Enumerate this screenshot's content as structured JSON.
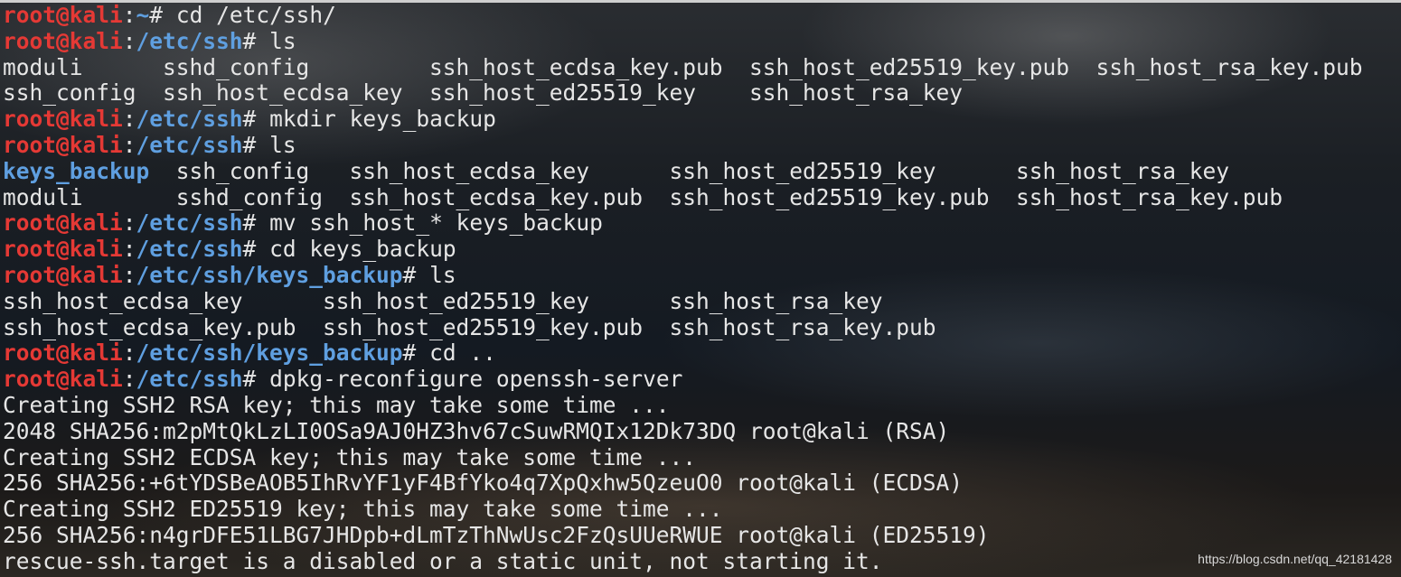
{
  "prompt": {
    "user_host": "root@kali",
    "colon": ":",
    "hash": "#"
  },
  "lines": [
    {
      "type": "prompt",
      "path": "~",
      "cmd": " cd /etc/ssh/"
    },
    {
      "type": "prompt",
      "path": "/etc/ssh",
      "cmd": " ls"
    },
    {
      "type": "text",
      "text": "moduli      sshd_config         ssh_host_ecdsa_key.pub  ssh_host_ed25519_key.pub  ssh_host_rsa_key.pub"
    },
    {
      "type": "text",
      "text": "ssh_config  ssh_host_ecdsa_key  ssh_host_ed25519_key    ssh_host_rsa_key"
    },
    {
      "type": "prompt",
      "path": "/etc/ssh",
      "cmd": " mkdir keys_backup"
    },
    {
      "type": "prompt",
      "path": "/etc/ssh",
      "cmd": " ls"
    },
    {
      "type": "listing",
      "dir": "keys_backup",
      "rest": "  ssh_config   ssh_host_ecdsa_key      ssh_host_ed25519_key      ssh_host_rsa_key"
    },
    {
      "type": "text",
      "text": "moduli       sshd_config  ssh_host_ecdsa_key.pub  ssh_host_ed25519_key.pub  ssh_host_rsa_key.pub"
    },
    {
      "type": "prompt",
      "path": "/etc/ssh",
      "cmd": " mv ssh_host_* keys_backup"
    },
    {
      "type": "prompt",
      "path": "/etc/ssh",
      "cmd": " cd keys_backup"
    },
    {
      "type": "prompt",
      "path": "/etc/ssh/keys_backup",
      "cmd": " ls"
    },
    {
      "type": "text",
      "text": "ssh_host_ecdsa_key      ssh_host_ed25519_key      ssh_host_rsa_key"
    },
    {
      "type": "text",
      "text": "ssh_host_ecdsa_key.pub  ssh_host_ed25519_key.pub  ssh_host_rsa_key.pub"
    },
    {
      "type": "prompt",
      "path": "/etc/ssh/keys_backup",
      "cmd": " cd .."
    },
    {
      "type": "prompt",
      "path": "/etc/ssh",
      "cmd": " dpkg-reconfigure openssh-server"
    },
    {
      "type": "text",
      "text": "Creating SSH2 RSA key; this may take some time ..."
    },
    {
      "type": "text",
      "text": "2048 SHA256:m2pMtQkLzLI0OSa9AJ0HZ3hv67cSuwRMQIx12Dk73DQ root@kali (RSA)"
    },
    {
      "type": "text",
      "text": "Creating SSH2 ECDSA key; this may take some time ..."
    },
    {
      "type": "text",
      "text": "256 SHA256:+6tYDSBeAOB5IhRvYF1yF4BfYko4q7XpQxhw5QzeuO0 root@kali (ECDSA)"
    },
    {
      "type": "text",
      "text": "Creating SSH2 ED25519 key; this may take some time ..."
    },
    {
      "type": "text",
      "text": "256 SHA256:n4grDFE51LBG7JHDpb+dLmTzThNwUsc2FzQsUUeRWUE root@kali (ED25519)"
    },
    {
      "type": "text",
      "text": "rescue-ssh.target is a disabled or a static unit, not starting it."
    }
  ],
  "watermark": "https://blog.csdn.net/qq_42181428",
  "colors": {
    "user_host": "#e53935",
    "path": "#5f9fe0",
    "text": "#e6e6e6"
  }
}
